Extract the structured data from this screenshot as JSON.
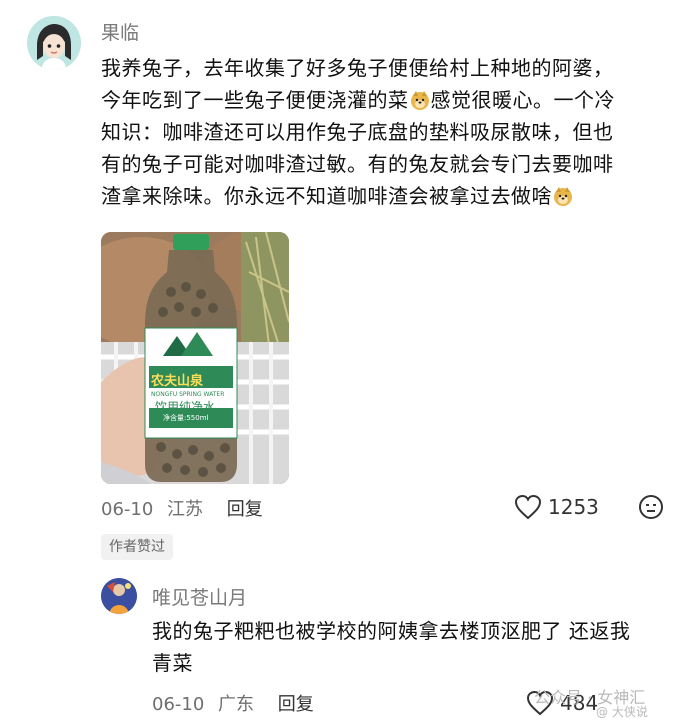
{
  "comment1": {
    "username": "果临",
    "lines": [
      "我养兔子，去年收集了好多兔子便便给村上种地的阿婆，",
      "今年吃到了一些兔子便便浇灌的菜",
      "感觉很暖心。一个冷",
      "知识：咖啡渣还可以用作兔子底盘的垫料吸尿散味，但也",
      "有的兔子可能对咖啡渣过敏。有的兔友就会专门去要咖啡",
      "渣拿来除味。你永远不知道咖啡渣会被拿过去做啥"
    ],
    "photo": {
      "bottle_brand": "农夫山泉",
      "bottle_label": "饮用纯净水",
      "bottle_subtext": "NONGFU SPRING WATER",
      "bottle_volume": "净含量:550ml"
    },
    "date": "06-10",
    "location": "江苏",
    "reply_label": "回复",
    "like_count": "1253",
    "author_liked_badge": "作者赞过"
  },
  "comment2": {
    "username": "唯见苍山月",
    "lines": [
      "我的兔子粑粑也被学校的阿姨拿去楼顶沤肥了 还返我",
      "青菜"
    ],
    "date": "06-10",
    "location": "广东",
    "reply_label": "回复",
    "like_count": "484"
  },
  "watermark": {
    "text1": "公众号 · 女神汇",
    "text2": "@ 大侠说"
  },
  "colors": {
    "text": "#111111",
    "meta": "#6f6f6f",
    "badge_bg": "#f1f1f1"
  }
}
